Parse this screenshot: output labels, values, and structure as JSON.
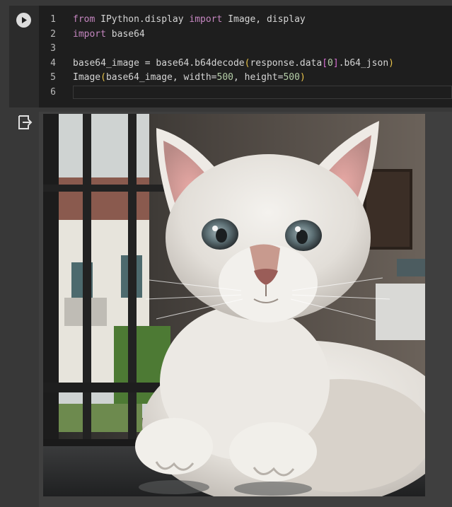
{
  "cell": {
    "run_button_label": "Run cell",
    "lines": [
      {
        "number": "1",
        "tokens": [
          {
            "t": "from",
            "c": "kw"
          },
          {
            "t": " IPython.display ",
            "c": "txt"
          },
          {
            "t": "import",
            "c": "kw"
          },
          {
            "t": " Image, display",
            "c": "txt"
          }
        ]
      },
      {
        "number": "2",
        "tokens": [
          {
            "t": "import",
            "c": "kw"
          },
          {
            "t": " base64",
            "c": "txt"
          }
        ]
      },
      {
        "number": "3",
        "tokens": []
      },
      {
        "number": "4",
        "tokens": [
          {
            "t": "base64_image = base64.b64decode",
            "c": "txt"
          },
          {
            "t": "(",
            "c": "br"
          },
          {
            "t": "response.data",
            "c": "txt"
          },
          {
            "t": "[",
            "c": "br2"
          },
          {
            "t": "0",
            "c": "num"
          },
          {
            "t": "]",
            "c": "br2"
          },
          {
            "t": ".b64_json",
            "c": "txt"
          },
          {
            "t": ")",
            "c": "br"
          }
        ]
      },
      {
        "number": "5",
        "tokens": [
          {
            "t": "Image",
            "c": "txt"
          },
          {
            "t": "(",
            "c": "br"
          },
          {
            "t": "base64_image, width=",
            "c": "txt"
          },
          {
            "t": "500",
            "c": "num"
          },
          {
            "t": ", height=",
            "c": "txt"
          },
          {
            "t": "500",
            "c": "num"
          },
          {
            "t": ")",
            "c": "br"
          }
        ]
      },
      {
        "number": "6",
        "tokens": []
      }
    ]
  },
  "output": {
    "icon": "output-redirect-icon",
    "image_subject": "white cat photo"
  },
  "colors": {
    "keyword": "#c586c0",
    "text": "#d4d4d4",
    "number": "#b5cea8",
    "bracket_level1": "#e8c34a",
    "bracket_level2": "#da70d6",
    "editor_bg": "#1e1e1e",
    "page_bg": "#383838"
  }
}
